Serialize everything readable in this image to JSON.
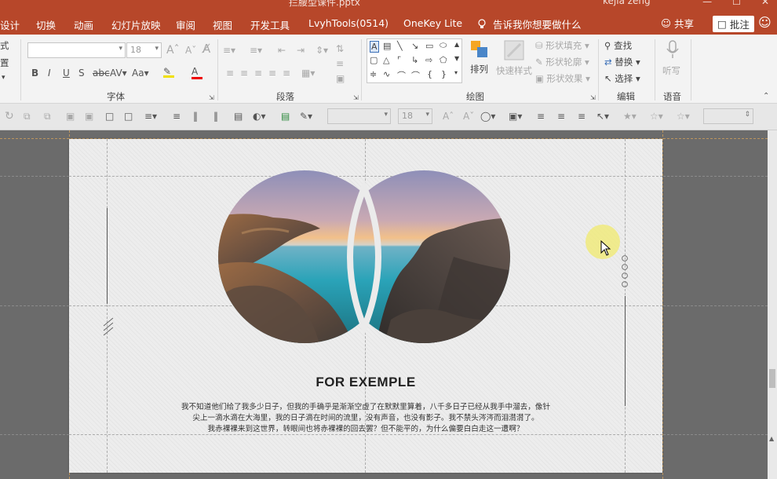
{
  "window": {
    "doc_title": "拦腰型课件.pptx",
    "user": "kejia zeng",
    "btn_min": "—",
    "btn_max": "☐",
    "btn_close": "✕"
  },
  "tabs": [
    {
      "label": "设计"
    },
    {
      "label": "切换"
    },
    {
      "label": "动画"
    },
    {
      "label": "幻灯片放映"
    },
    {
      "label": "审阅"
    },
    {
      "label": "视图"
    },
    {
      "label": "开发工具"
    },
    {
      "label": "LvyhTools(0514)"
    },
    {
      "label": "OneKey Lite"
    }
  ],
  "tell_me": "告诉我你想要做什么",
  "share_label": "共享",
  "comment_label": "批注",
  "ribbon": {
    "font_group": "字体",
    "paragraph_group": "段落",
    "drawing_group": "绘图",
    "editing_group": "编辑",
    "voice_group": "语音",
    "font_size": "18",
    "left_partial_1": "式",
    "left_partial_2": "置",
    "arrange": "排列",
    "quick_styles": "快速样式",
    "shape_fill": "形状填充",
    "shape_outline": "形状轮廓",
    "shape_effects": "形状效果",
    "find": "查找",
    "replace": "替换",
    "select": "选择",
    "dictate": "听写"
  },
  "drawbar": {
    "font_size": "18"
  },
  "slide": {
    "heading": "FOR EXEMPLE",
    "body_lines": [
      "我不知道他们给了我多少日子，但我的手确乎是渐渐空虚了在默默里算着，八千多日子已经从我手中溜去，像针",
      "尖上一滴水滴在大海里，我的日子滴在时间的流里，没有声音，也没有影子。我不禁头涔涔而泪潸潸了。",
      "我赤裸裸来到这世界，转眼间也将赤裸裸的回去罢？但不能平的，为什么偏要白白走这一遭啊？"
    ]
  }
}
